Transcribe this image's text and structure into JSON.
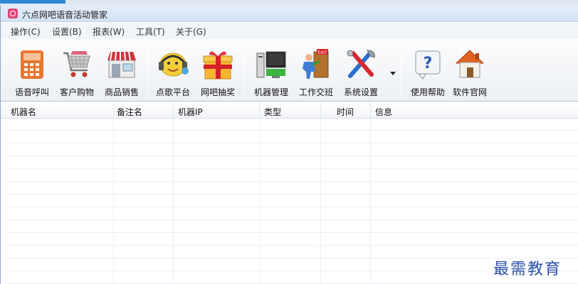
{
  "window": {
    "title": "六点网吧语音活动管家"
  },
  "menu": [
    "操作(C)",
    "设置(B)",
    "报表(W)",
    "工具(T)",
    "关于(G)"
  ],
  "toolbar": [
    {
      "label": "语音呼叫",
      "icon": "phone-icon"
    },
    {
      "label": "客户购物",
      "icon": "shopping-cart-icon"
    },
    {
      "label": "商品销售",
      "icon": "store-icon"
    },
    {
      "label": "点歌平台",
      "icon": "headset-icon"
    },
    {
      "label": "网吧抽奖",
      "icon": "gift-icon"
    },
    {
      "label": "机器管理",
      "icon": "computer-icon"
    },
    {
      "label": "工作交班",
      "icon": "exit-door-icon"
    },
    {
      "label": "系统设置",
      "icon": "tools-icon"
    },
    {
      "label": "使用帮助",
      "icon": "help-icon"
    },
    {
      "label": "软件官网",
      "icon": "home-icon"
    }
  ],
  "table": {
    "columns": [
      "机器名",
      "备注名",
      "机器IP",
      "类型",
      "时间",
      "信息"
    ],
    "rows": []
  },
  "watermark": "最需教育",
  "colors": {
    "title_accent": "#2f86d6",
    "watermark": "#2c4fa8"
  }
}
